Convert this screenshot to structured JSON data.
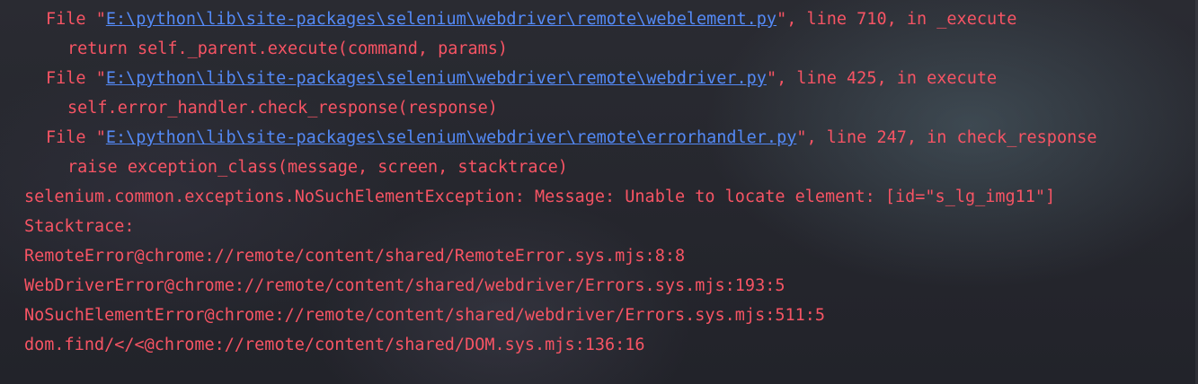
{
  "colors": {
    "error_text": "#f75464",
    "link": "#548af7",
    "background": "#26272e"
  },
  "traceback": [
    {
      "prefix": "File \"",
      "path": "E:\\python\\lib\\site-packages\\selenium\\webdriver\\remote\\webelement.py",
      "suffix": "\", line 710, in _execute",
      "code": "return self._parent.execute(command, params)"
    },
    {
      "prefix": "File \"",
      "path": "E:\\python\\lib\\site-packages\\selenium\\webdriver\\remote\\webdriver.py",
      "suffix": "\", line 425, in execute",
      "code": "self.error_handler.check_response(response)"
    },
    {
      "prefix": "File \"",
      "path": "E:\\python\\lib\\site-packages\\selenium\\webdriver\\remote\\errorhandler.py",
      "suffix": "\", line 247, in check_response",
      "code": "raise exception_class(message, screen, stacktrace)"
    }
  ],
  "exception_message": "selenium.common.exceptions.NoSuchElementException: Message: Unable to locate element: [id=\"s_lg_img11\"]",
  "stacktrace_label": "Stacktrace:",
  "stacktrace": [
    "RemoteError@chrome://remote/content/shared/RemoteError.sys.mjs:8:8",
    "WebDriverError@chrome://remote/content/shared/webdriver/Errors.sys.mjs:193:5",
    "NoSuchElementError@chrome://remote/content/shared/webdriver/Errors.sys.mjs:511:5",
    "dom.find/</<@chrome://remote/content/shared/DOM.sys.mjs:136:16"
  ]
}
